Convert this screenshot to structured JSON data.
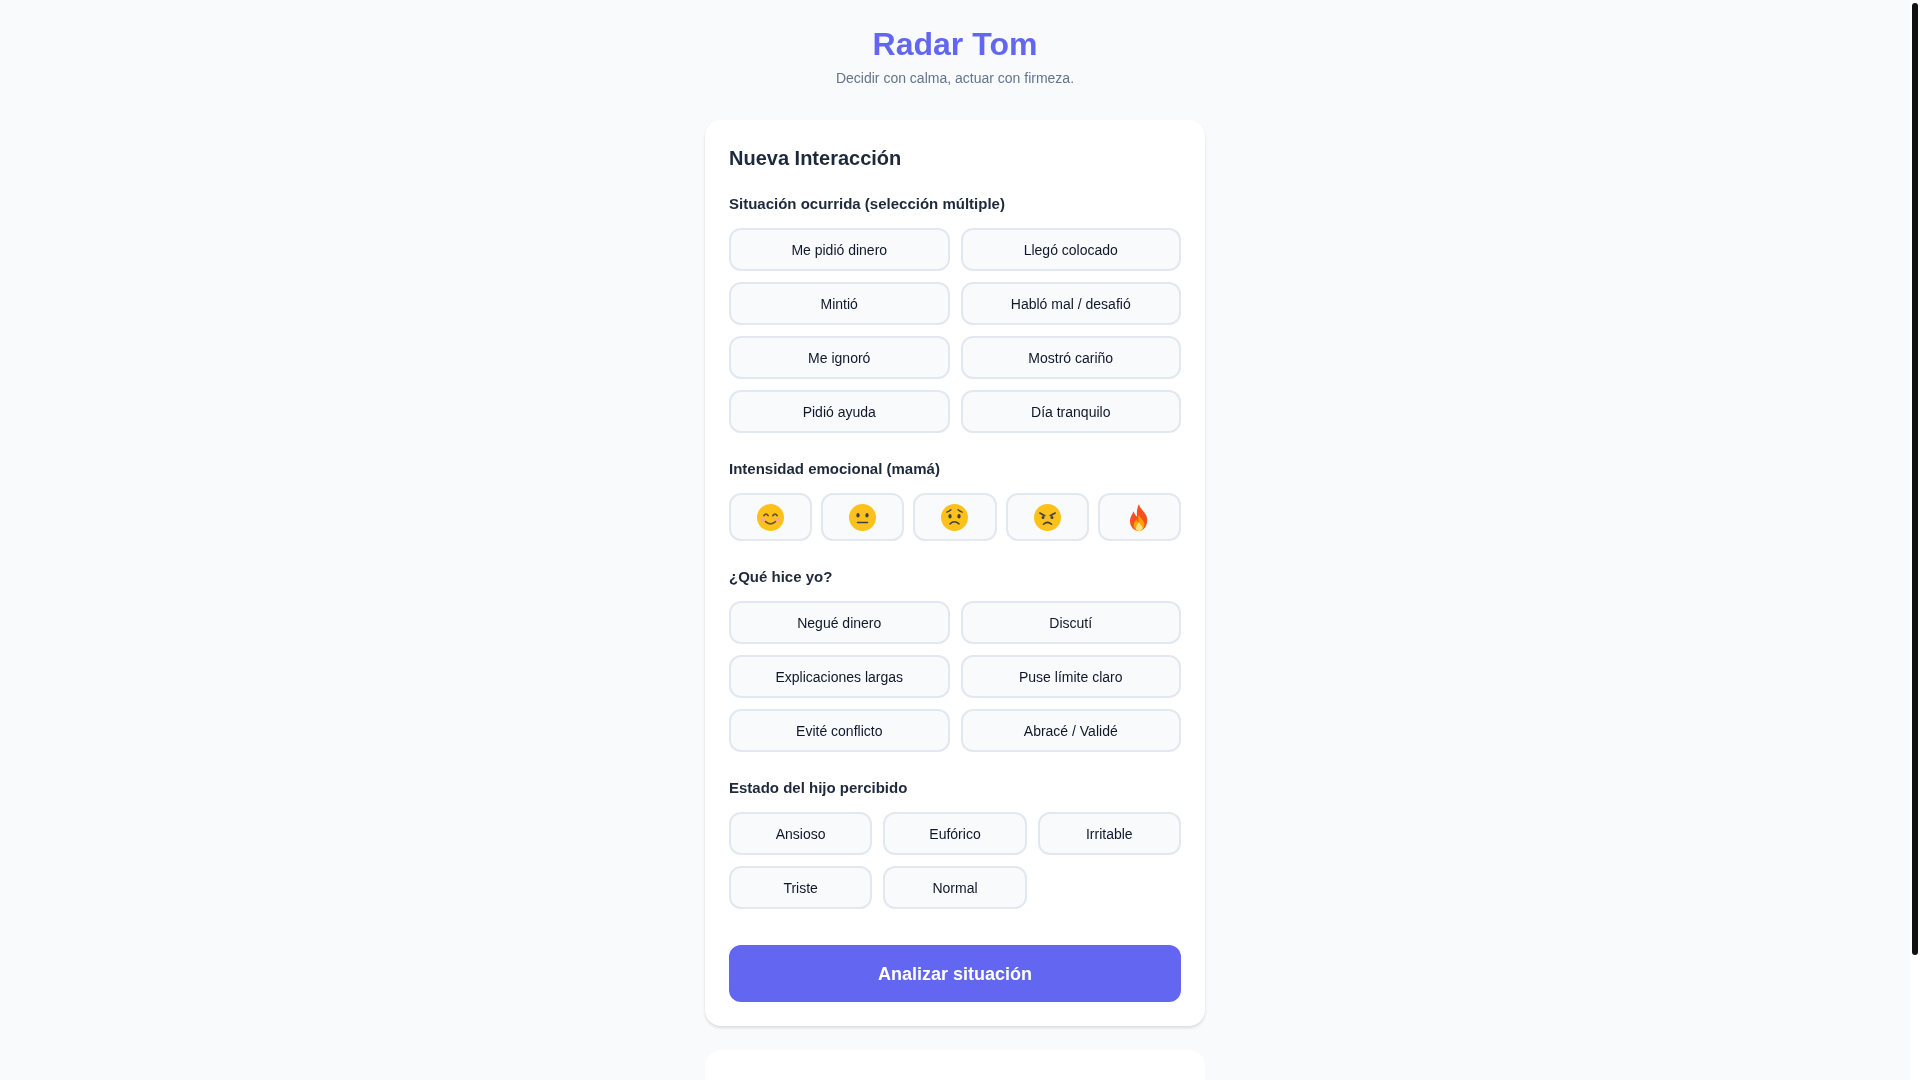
{
  "header": {
    "title": "Radar Tom",
    "subtitle": "Decidir con calma, actuar con firmeza."
  },
  "form": {
    "title": "Nueva Interacción",
    "sections": [
      {
        "label": "Situación ocurrida (selección múltiple)",
        "kind": "pair-grid",
        "options": [
          {
            "label": "Me pidió dinero",
            "selected": false
          },
          {
            "label": "Llegó colocado",
            "selected": false
          },
          {
            "label": "Mintió",
            "selected": false
          },
          {
            "label": "Habló mal / desafió",
            "selected": false
          },
          {
            "label": "Me ignoró",
            "selected": false
          },
          {
            "label": "Mostró cariño",
            "selected": false
          },
          {
            "label": "Pidió ayuda",
            "selected": false
          },
          {
            "label": "Día tranquilo",
            "selected": false
          }
        ]
      },
      {
        "label": "Intensidad emocional (mamá)",
        "kind": "emoji-row",
        "options": [
          {
            "kind": "smiling",
            "selected": false
          },
          {
            "kind": "neutral",
            "selected": false
          },
          {
            "kind": "worried",
            "selected": false
          },
          {
            "kind": "angry",
            "selected": false
          },
          {
            "kind": "fire",
            "selected": false
          }
        ]
      },
      {
        "label": "¿Qué hice yo?",
        "kind": "pair-grid",
        "options": [
          {
            "label": "Negué dinero",
            "selected": false
          },
          {
            "label": "Discutí",
            "selected": false
          },
          {
            "label": "Explicaciones largas",
            "selected": false
          },
          {
            "label": "Puse límite claro",
            "selected": false
          },
          {
            "label": "Evité conflicto",
            "selected": false
          },
          {
            "label": "Abracé / Validé",
            "selected": false
          }
        ]
      },
      {
        "label": "Estado del hijo percibido",
        "kind": "triple-grid",
        "options": [
          {
            "label": "Ansioso",
            "selected": false
          },
          {
            "label": "Eufórico",
            "selected": false
          },
          {
            "label": "Irritable",
            "selected": false
          },
          {
            "label": "Triste",
            "selected": false
          },
          {
            "label": "Normal",
            "selected": false
          }
        ]
      }
    ],
    "submit_button": "Analizar situación"
  }
}
